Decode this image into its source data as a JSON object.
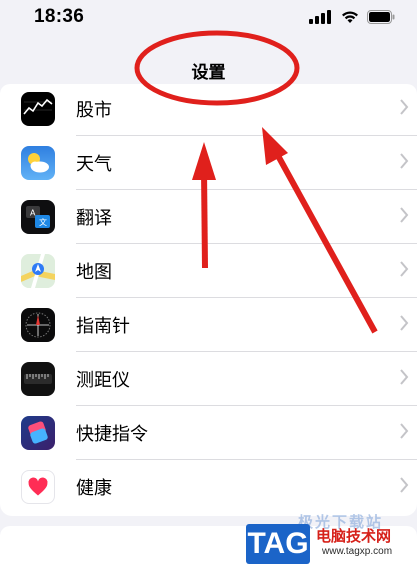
{
  "status_bar": {
    "time": "18:36"
  },
  "nav": {
    "title": "设置"
  },
  "settings_items": [
    {
      "label": "股市",
      "icon": "stocks-icon"
    },
    {
      "label": "天气",
      "icon": "weather-icon"
    },
    {
      "label": "翻译",
      "icon": "translate-icon"
    },
    {
      "label": "地图",
      "icon": "maps-icon"
    },
    {
      "label": "指南针",
      "icon": "compass-icon"
    },
    {
      "label": "测距仪",
      "icon": "measure-icon"
    },
    {
      "label": "快捷指令",
      "icon": "shortcuts-icon"
    },
    {
      "label": "健康",
      "icon": "health-icon"
    }
  ],
  "watermark": {
    "logo": "TAG",
    "site_name": "电脑技术网",
    "site_url": "www.tagxp.com",
    "overlay_text": "极光下载站"
  },
  "colors": {
    "annotation_red": "#e0201c",
    "logo_blue": "#1b64c8"
  }
}
